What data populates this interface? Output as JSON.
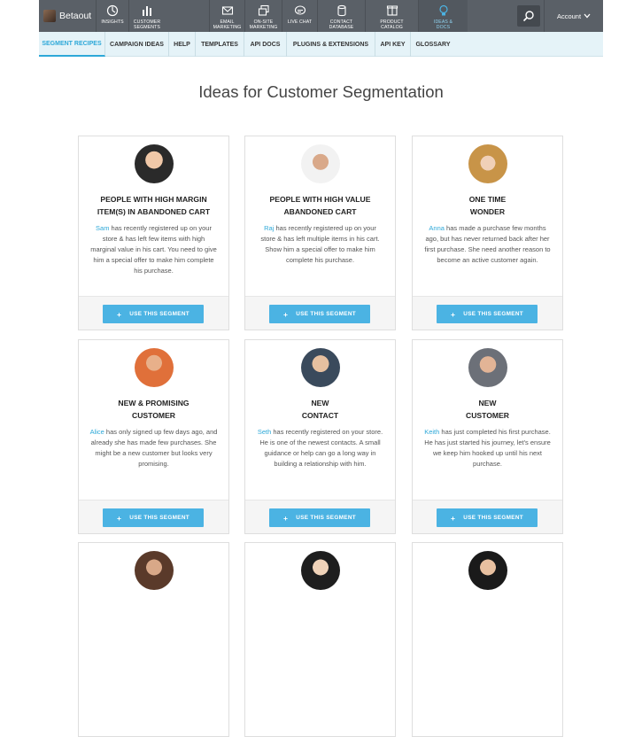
{
  "brand": {
    "name": "Betaout"
  },
  "topnav": [
    {
      "label": "INSIGHTS",
      "icon": "insights-icon"
    },
    {
      "label": "CUSTOMER\nSEGMENTS",
      "icon": "bar-chart-icon"
    },
    {
      "label": "EMAIL\nMARKETING",
      "icon": "envelope-icon"
    },
    {
      "label": "ON-SITE\nMARKETING",
      "icon": "windows-icon"
    },
    {
      "label": "LIVE CHAT",
      "icon": "chat-bubble-icon"
    },
    {
      "label": "CONTACT\nDATABASE",
      "icon": "database-icon"
    },
    {
      "label": "PRODUCT\nCATALOG",
      "icon": "box-icon"
    },
    {
      "label": "IDEAS &\nDOCS",
      "icon": "lightbulb-icon"
    }
  ],
  "account": {
    "label": "Account"
  },
  "subnav": [
    "SEGMENT RECIPES",
    "CAMPAIGN IDEAS",
    "HELP",
    "TEMPLATES",
    "API DOCS",
    "PLUGINS & EXTENSIONS",
    "API KEY",
    "GLOSSARY"
  ],
  "page_title": "Ideas for Customer Segmentation",
  "cards": [
    {
      "title": "PEOPLE WITH HIGH MARGIN\nITEM(S) IN ABANDONED CART",
      "name": "Sam",
      "desc": " has recently registered up on your store & has left few items with high marginal value in his cart. You need to give him a special offer to make him complete his purchase.",
      "button": "USE THIS SEGMENT"
    },
    {
      "title": "PEOPLE WITH HIGH VALUE\nABANDONED CART",
      "name": "Raj",
      "desc": " has recently registered up on your store & has left multiple items in his cart. Show him a special offer to make him complete his purchase.",
      "button": "USE THIS SEGMENT"
    },
    {
      "title": "ONE TIME\nWONDER",
      "name": "Anna",
      "desc": " has made a purchase few months ago, but has never returned back after her first purchase. She need another reason to become an active customer again.",
      "button": "USE THIS SEGMENT"
    },
    {
      "title": "NEW & PROMISING\nCUSTOMER",
      "name": "Alice",
      "desc": " has only signed up few days ago, and already she has made few purchases. She might be a new customer but looks very promising.",
      "button": "USE THIS SEGMENT"
    },
    {
      "title": "NEW\nCONTACT",
      "name": "Seth",
      "desc": " has recently registered on your store. He is one of the newest contacts. A small guidance or help can go a long way in building a relationship with him.",
      "button": "USE THIS SEGMENT"
    },
    {
      "title": "NEW\nCUSTOMER",
      "name": "Keith",
      "desc": " has just completed his first purchase. He has just started his journey, let's ensure we keep him hooked up until his next purchase.",
      "button": "USE THIS SEGMENT"
    }
  ],
  "colors": {
    "topbar": "#5a6067",
    "subnav_bg": "#e5f3f8",
    "accent": "#2da8d8",
    "button": "#4bb3e3"
  }
}
